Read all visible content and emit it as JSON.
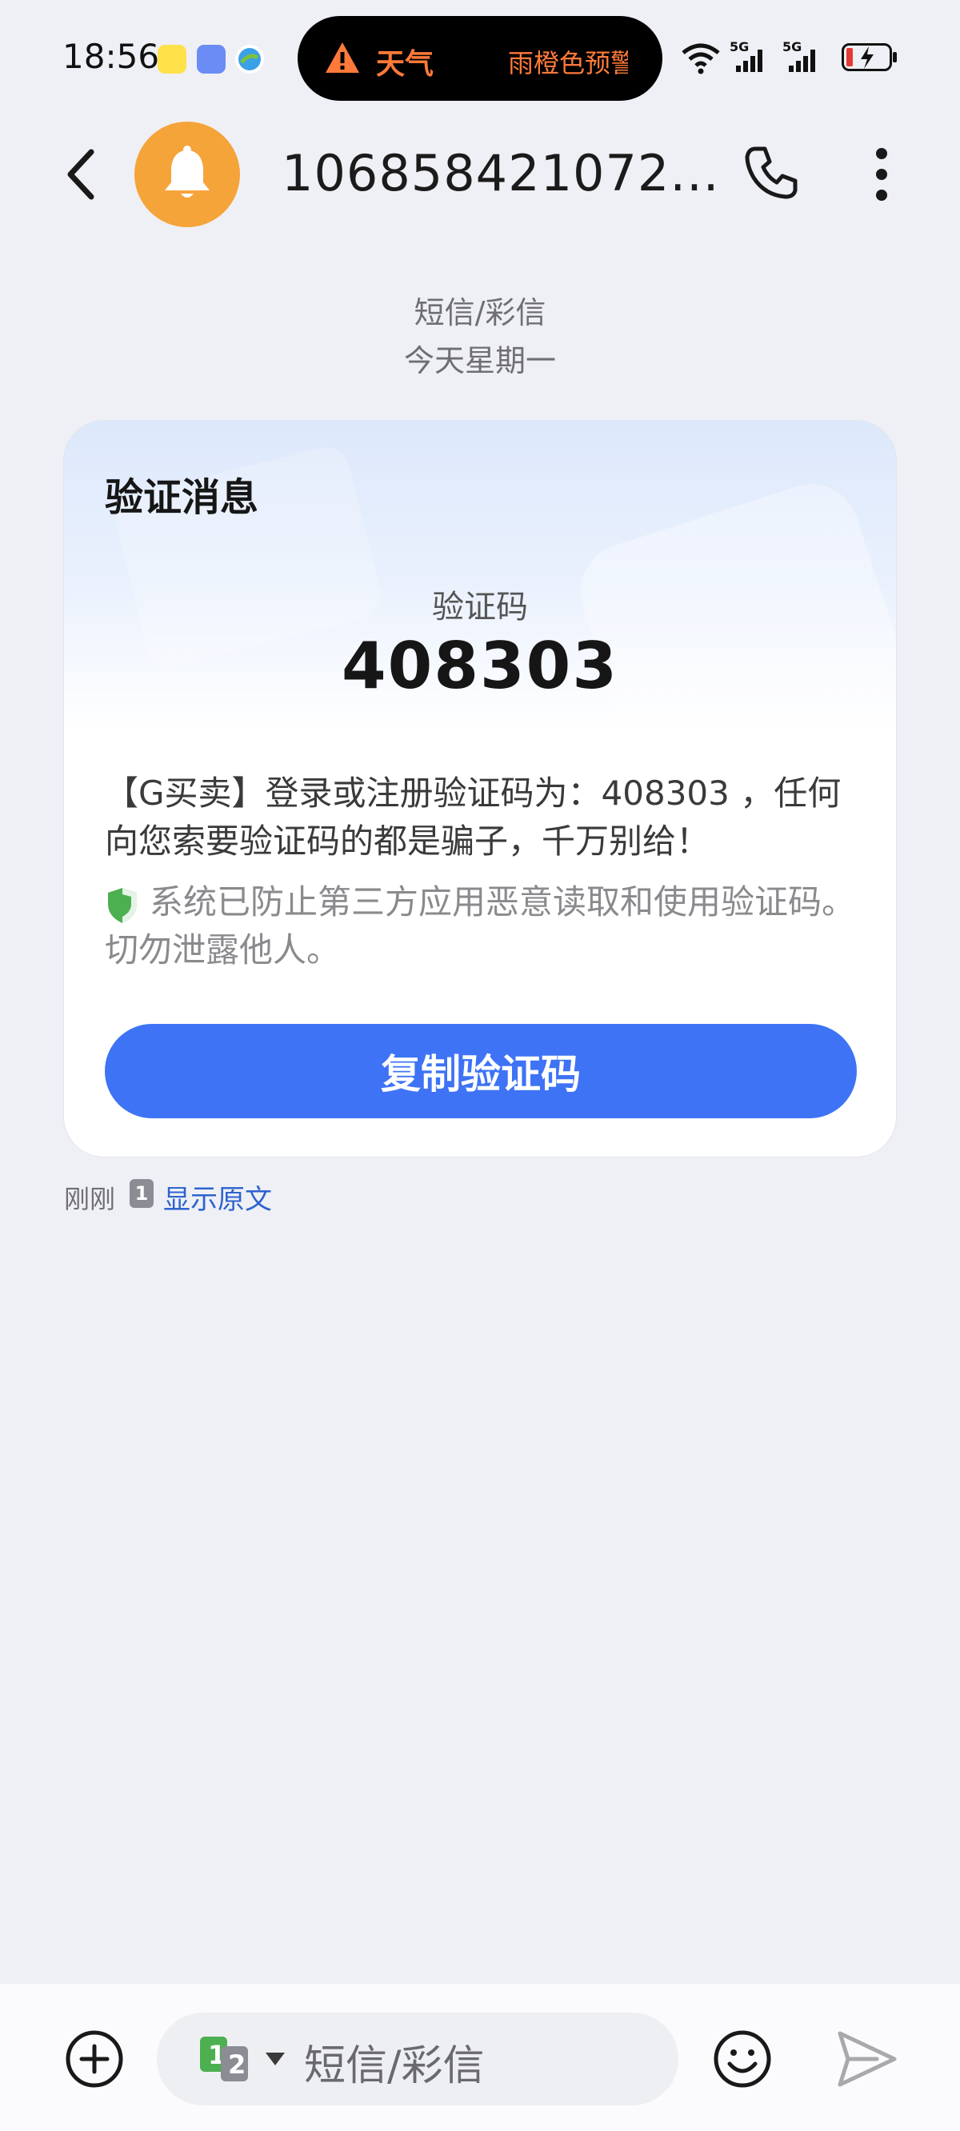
{
  "status_bar": {
    "time": "18:56",
    "island_weather": "天气",
    "island_alert": "雨橙色预警",
    "network_1": "5G",
    "network_2": "5G"
  },
  "header": {
    "contact": "106858421072...",
    "back_icon": "chevron-left-icon",
    "avatar_icon": "bell-icon",
    "call_icon": "phone-icon",
    "more_icon": "more-vertical-icon"
  },
  "thread": {
    "channel": "短信/彩信",
    "date": "今天星期一"
  },
  "card": {
    "title": "验证消息",
    "code_label": "验证码",
    "code": "408303",
    "body": "【G买卖】登录或注册验证码为：408303 ，任何向您索要验证码的都是骗子，千万别给！",
    "security_notice": "系统已防止第三方应用恶意读取和使用验证码。切勿泄露他人。",
    "copy_button": "复制验证码"
  },
  "message_meta": {
    "time": "刚刚",
    "sim_slot": "1",
    "show_original": "显示原文"
  },
  "composer": {
    "placeholder": "短信/彩信",
    "sim_label_1": "1",
    "sim_label_2": "2"
  },
  "colors": {
    "accent": "#3e73f5",
    "avatar": "#f5a43a",
    "alert": "#ff7a3a",
    "link": "#2e63cf",
    "shield": "#4caf50"
  }
}
